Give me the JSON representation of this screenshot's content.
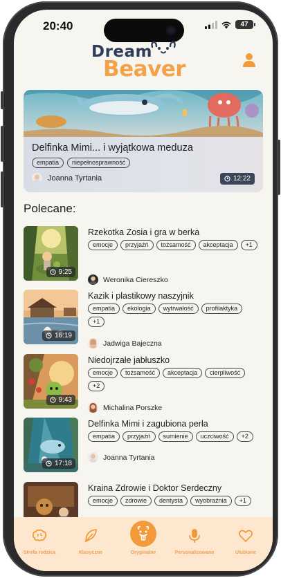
{
  "status_bar": {
    "time": "20:40",
    "battery": "47"
  },
  "logo": {
    "line1": "Dream",
    "line2": "Beaver"
  },
  "featured": {
    "title": "Delfinka Mimi... i wyjątkowa meduza",
    "tags": [
      "empatia",
      "niepełnosprawność"
    ],
    "author": "Joanna Tyrtania",
    "duration": "12:22"
  },
  "section_title": "Polecane:",
  "stories": [
    {
      "title": "Rzekotka Zosia i gra w berka",
      "tags": [
        "emocje",
        "przyjaźń",
        "tożsamość",
        "akceptacja",
        "+1"
      ],
      "author": "Weronika Ciereszko",
      "duration": "9:25"
    },
    {
      "title": "Kazik i plastikowy naszyjnik",
      "tags": [
        "empatia",
        "ekologia",
        "wytrwałość",
        "profilaktyka",
        "+1"
      ],
      "author": "Jadwiga Bajeczna",
      "duration": "16:19"
    },
    {
      "title": "Niedojrzałe jabłuszko",
      "tags": [
        "emocje",
        "tożsamość",
        "akceptacja",
        "cierpliwość",
        "+2"
      ],
      "author": "Michalina Porszke",
      "duration": "9:43"
    },
    {
      "title": "Delfinka Mimi i zagubiona perła",
      "tags": [
        "empatia",
        "przyjaźń",
        "sumienie",
        "uczciwość",
        "+2"
      ],
      "author": "Joanna Tyrtania",
      "duration": "17:18"
    },
    {
      "title": "Kraina Zdrowie i Doktor Serdeczny",
      "tags": [
        "emocje",
        "zdrowie",
        "dentysta",
        "wyobraźnia",
        "+1"
      ],
      "author": "",
      "duration": ""
    }
  ],
  "nav": [
    {
      "label": "Strefa rodzica",
      "icon": "brain-icon"
    },
    {
      "label": "Klasyczne",
      "icon": "feather-icon"
    },
    {
      "label": "Oryginalne",
      "icon": "beaver-icon"
    },
    {
      "label": "Personalizowane",
      "icon": "microphone-icon"
    },
    {
      "label": "Ulubione",
      "icon": "heart-icon"
    }
  ],
  "colors": {
    "accent": "#f39a3b",
    "nav_bg": "#fde8cf",
    "logo_navy": "#2d3d5a",
    "background": "#f7f5f0"
  }
}
